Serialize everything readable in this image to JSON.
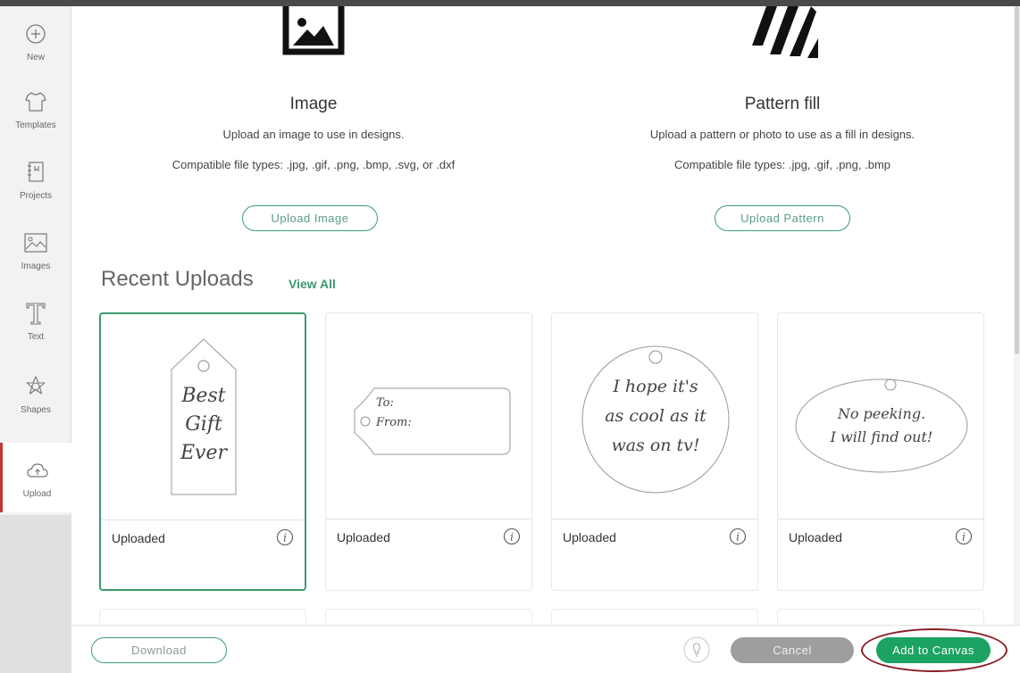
{
  "sidebar": {
    "items": [
      {
        "label": "New",
        "icon": "plus-circle-icon"
      },
      {
        "label": "Templates",
        "icon": "tshirt-icon"
      },
      {
        "label": "Projects",
        "icon": "projects-icon"
      },
      {
        "label": "Images",
        "icon": "image-icon"
      },
      {
        "label": "Text",
        "icon": "text-icon"
      },
      {
        "label": "Shapes",
        "icon": "shapes-icon"
      },
      {
        "label": "Upload",
        "icon": "cloud-upload-icon"
      }
    ],
    "active_item": "Upload"
  },
  "image_upload": {
    "title": "Image",
    "description": "Upload an image to use in designs.",
    "file_types": "Compatible file types: .jpg, .gif, .png, .bmp, .svg, or .dxf",
    "button_label": "Upload Image"
  },
  "pattern_upload": {
    "title": "Pattern fill",
    "description": "Upload a pattern or photo to use as a fill in designs.",
    "file_types": "Compatible file types: .jpg, .gif, .png, .bmp",
    "button_label": "Upload Pattern"
  },
  "recent": {
    "title": "Recent Uploads",
    "view_all": "View All",
    "cards": [
      {
        "label": "Uploaded",
        "text_lines": [
          "Best",
          "Gift",
          "Ever"
        ],
        "selected": true
      },
      {
        "label": "Uploaded",
        "text_lines": [
          "To:",
          "From:"
        ],
        "selected": false
      },
      {
        "label": "Uploaded",
        "text_lines": [
          "I hope it's",
          "as cool as it",
          "was on tv!"
        ],
        "selected": false
      },
      {
        "label": "Uploaded",
        "text_lines": [
          "No peeking.",
          "I will find out!"
        ],
        "selected": false
      }
    ]
  },
  "footer": {
    "download": "Download",
    "cancel": "Cancel",
    "add_to_canvas": "Add to Canvas"
  },
  "colors": {
    "accent": "#1ca263",
    "outline_green": "#3d9f76",
    "cancel_gray": "#9e9e9e",
    "highlight_ring": "#8b1c24"
  }
}
